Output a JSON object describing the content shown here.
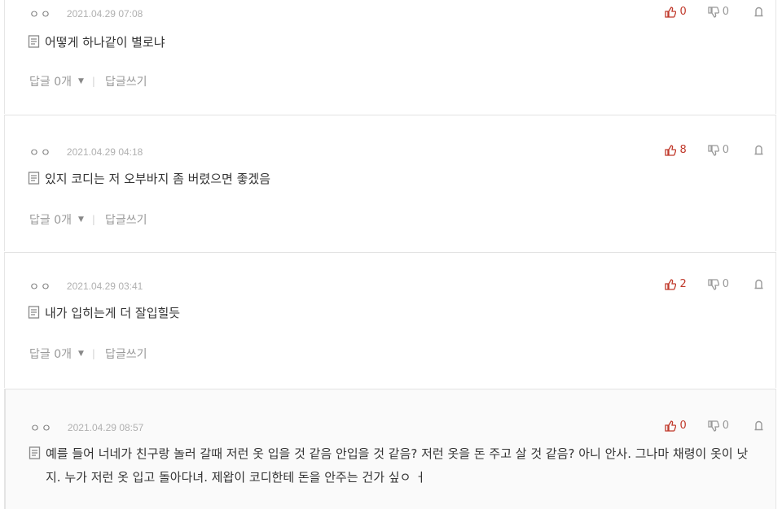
{
  "comments": [
    {
      "author": "ㅇㅇ",
      "date": "2021.04.29 07:08",
      "likes": "0",
      "dislikes": "0",
      "text": "어떻게 하나같이 별로냐",
      "replies": "답글 0개",
      "write": "답글쓰기"
    },
    {
      "author": "ㅇㅇ",
      "date": "2021.04.29 04:18",
      "likes": "8",
      "dislikes": "0",
      "text": "있지 코디는 저 오부바지 좀 버렸으면 좋겠음",
      "replies": "답글 0개",
      "write": "답글쓰기"
    },
    {
      "author": "ㅇㅇ",
      "date": "2021.04.29 03:41",
      "likes": "2",
      "dislikes": "0",
      "text": "내가 입히는게 더 잘입힐듯",
      "replies": "답글 0개",
      "write": "답글쓰기"
    },
    {
      "author": "ㅇㅇ",
      "date": "2021.04.29 08:57",
      "likes": "0",
      "dislikes": "0",
      "text": "예를 들어 너네가 친구랑 놀러 갈때 저런 옷 입을 것 같음 안입을 것 같음? 저런 옷을 돈 주고 살 것 같음? 아니 안사. 그나마 채령이 옷이 낫지. 누가 저런 옷 입고 돌아다녀. 제왑이 코디한테 돈을 안주는 건가 싶ㅇ ㅓ"
    }
  ],
  "icons": {
    "like": "thumbs-up-icon",
    "dislike": "thumbs-down-icon",
    "report": "report-icon",
    "memo": "memo-icon"
  },
  "colors": {
    "like": "#c0392b",
    "muted": "#999999",
    "date": "#b0b0b0"
  }
}
